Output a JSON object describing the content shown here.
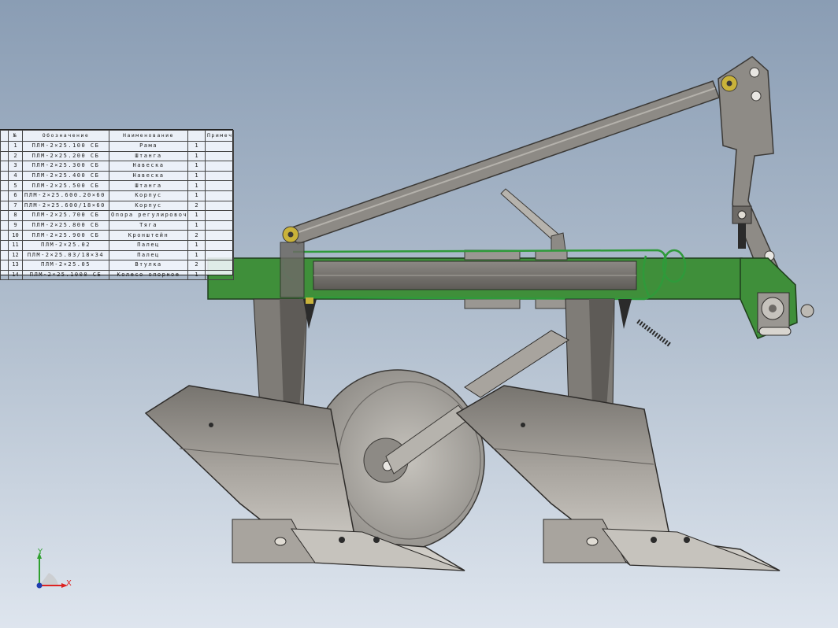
{
  "bom": {
    "headers": [
      "",
      "№",
      "Обозначение",
      "Наименование",
      "",
      "Примечание"
    ],
    "rows": [
      {
        "no": "1",
        "designation": "ПЛМ-2×25.100 СБ",
        "name": "Рама",
        "qty": "1"
      },
      {
        "no": "2",
        "designation": "ПЛМ-2×25.200 СБ",
        "name": "Штанга",
        "qty": "1"
      },
      {
        "no": "3",
        "designation": "ПЛМ-2×25.300 СБ",
        "name": "Навеска",
        "qty": "1"
      },
      {
        "no": "4",
        "designation": "ПЛМ-2×25.400 СБ",
        "name": "Навеска",
        "qty": "1"
      },
      {
        "no": "5",
        "designation": "ПЛМ-2×25.500 СБ",
        "name": "Штанга",
        "qty": "1"
      },
      {
        "no": "6",
        "designation": "ПЛМ-2×25.600.20×60 СБ",
        "name": "Корпус",
        "qty": "1"
      },
      {
        "no": "7",
        "designation": "ПЛМ-2×25.600/18×60 СБ",
        "name": "Корпус",
        "qty": "2"
      },
      {
        "no": "8",
        "designation": "ПЛМ-2×25.700 СБ",
        "name": "Опора регулировочная",
        "qty": "1"
      },
      {
        "no": "9",
        "designation": "ПЛМ-2×25.800 СБ",
        "name": "Тяга",
        "qty": "1"
      },
      {
        "no": "10",
        "designation": "ПЛМ-2×25.900 СБ",
        "name": "Кронштейн",
        "qty": "2"
      },
      {
        "no": "11",
        "designation": "ПЛМ-2×25.02",
        "name": "Палец",
        "qty": "1"
      },
      {
        "no": "12",
        "designation": "ПЛМ-2×25.03/18×34",
        "name": "Палец",
        "qty": "1"
      },
      {
        "no": "13",
        "designation": "ПЛМ-2×25.05",
        "name": "Втулка",
        "qty": "2"
      },
      {
        "no": "14",
        "designation": "ПЛМ-2×25.1000 СБ",
        "name": "Колесо опорное",
        "qty": "1"
      }
    ]
  },
  "triad": {
    "x_label": "X",
    "y_label": "Y"
  },
  "colors": {
    "frame_green": "#3f8f3a",
    "steel_gray": "#8d8a85",
    "dark_steel": "#5e5b57",
    "light_steel": "#bdbab4",
    "bolt_yellow": "#c9b23a",
    "hose_green": "#2f9a3a"
  }
}
